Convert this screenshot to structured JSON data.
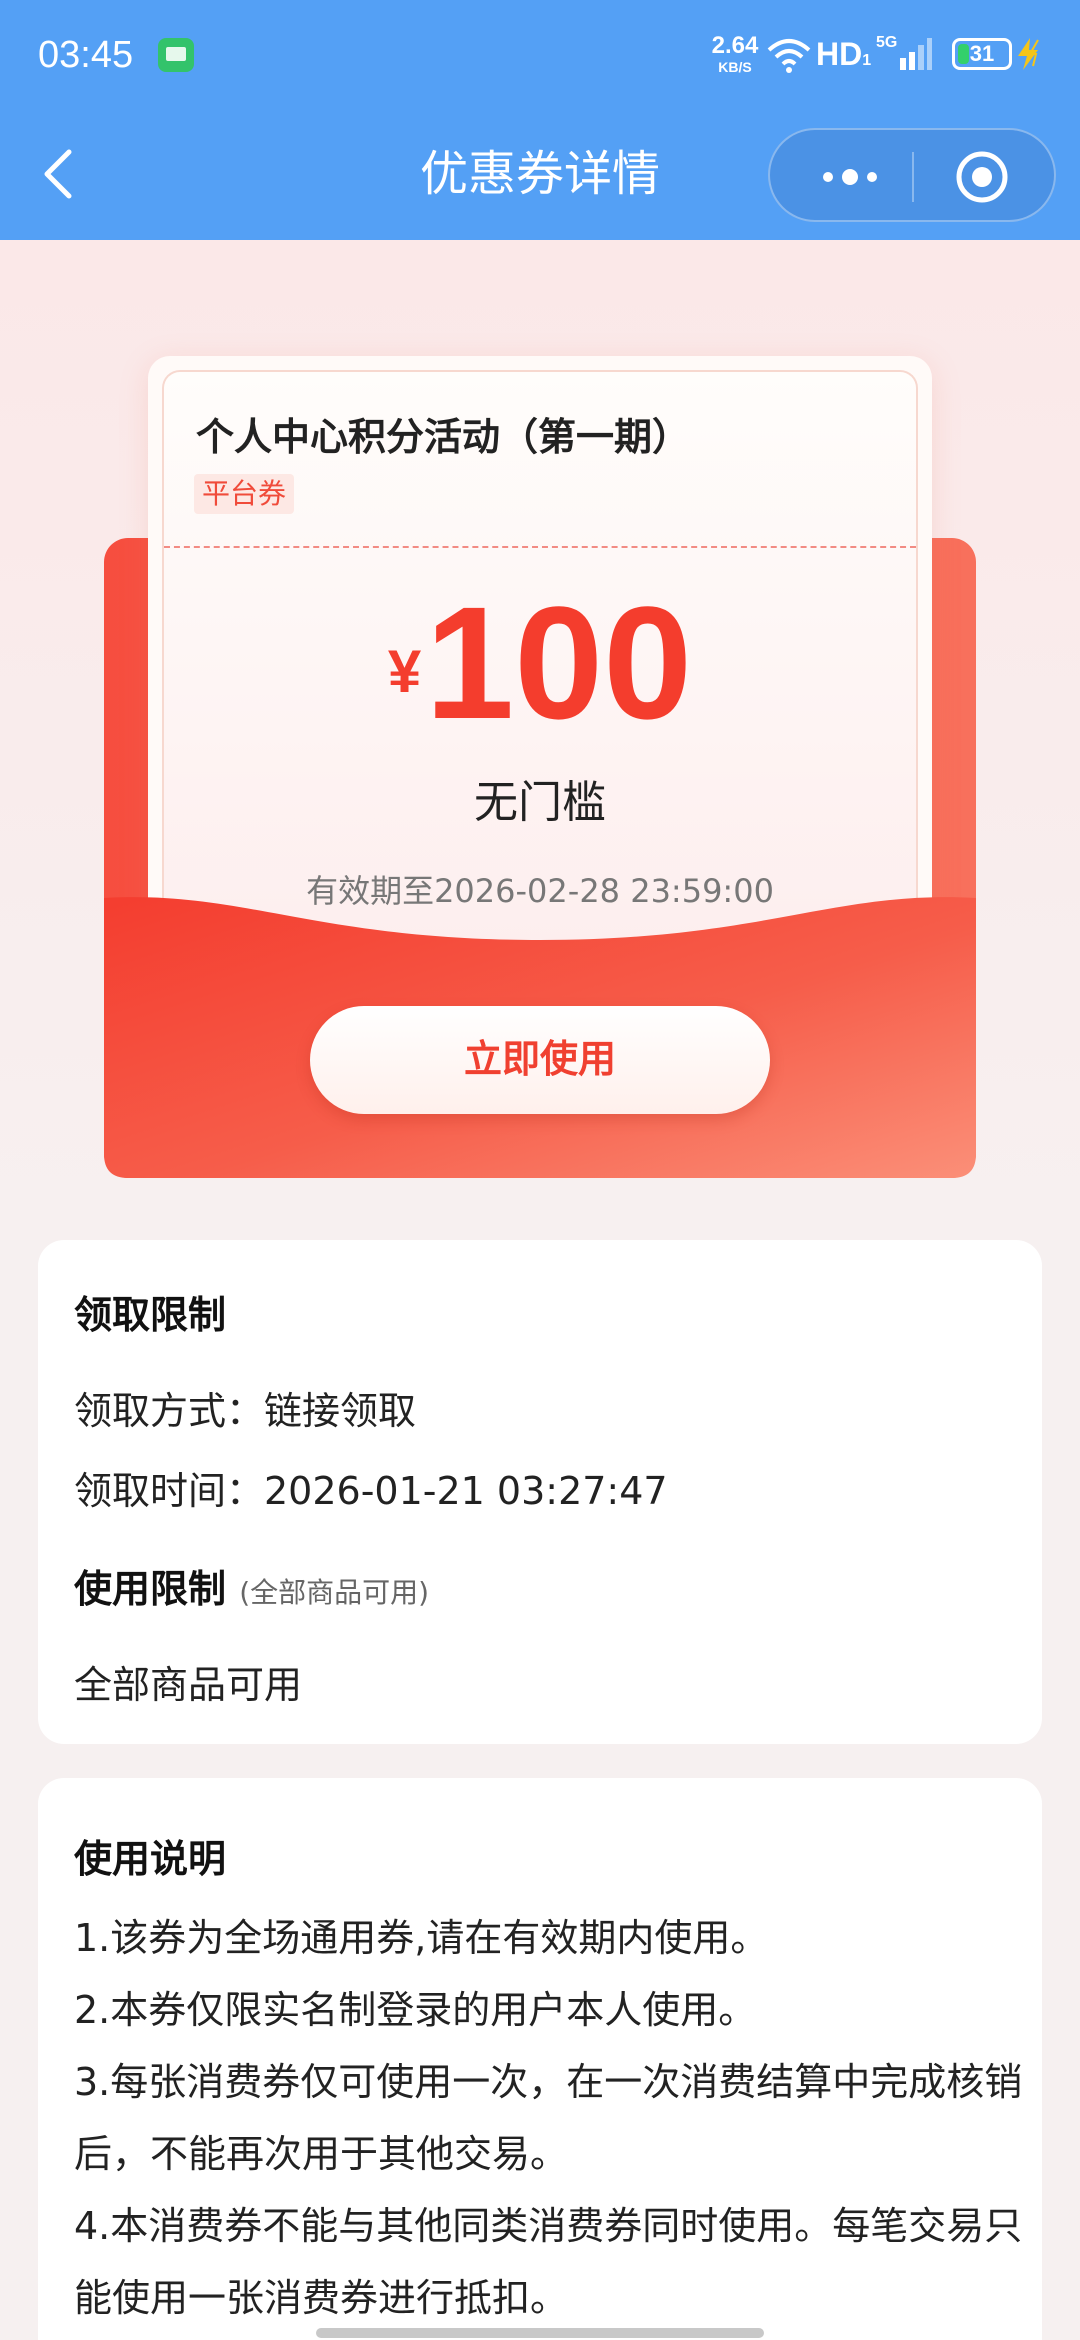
{
  "status_bar": {
    "time": "03:45",
    "net_speed_value": "2.64",
    "net_speed_unit": "KB/S",
    "hd_label": "HD",
    "hd_sub": "1",
    "network_type": "5G",
    "battery_level": "31",
    "battery_fraction": 0.31
  },
  "nav": {
    "title": "优惠券详情"
  },
  "coupon": {
    "name": "个人中心积分活动（第一期）",
    "tag": "平台券",
    "currency": "¥",
    "amount": "100",
    "threshold": "无门槛",
    "validity": "有效期至2026-02-28 23:59:00",
    "use_button": "立即使用"
  },
  "claim_limits": {
    "heading": "领取限制",
    "method": "领取方式：链接领取",
    "time": "领取时间：2026-01-21 03:27:47"
  },
  "usage_limits": {
    "heading": "使用限制",
    "heading_note": "(全部商品可用)",
    "value": "全部商品可用"
  },
  "instructions": {
    "heading": "使用说明",
    "items": [
      "1.该券为全场通用券,请在有效期内使用。",
      "2.本券仅限实名制登录的用户本人使用。",
      "3.每张消费券仅可使用一次，在一次消费结算中完成核销后，不能再次用于其他交易。",
      "4.本消费券不能与其他同类消费券同时使用。每笔交易只能使用一张消费券进行抵扣。"
    ]
  },
  "colors": {
    "header_blue": "#54a0f5",
    "coupon_red": "#f43d2d",
    "envelope_red": "#f64e3f"
  }
}
